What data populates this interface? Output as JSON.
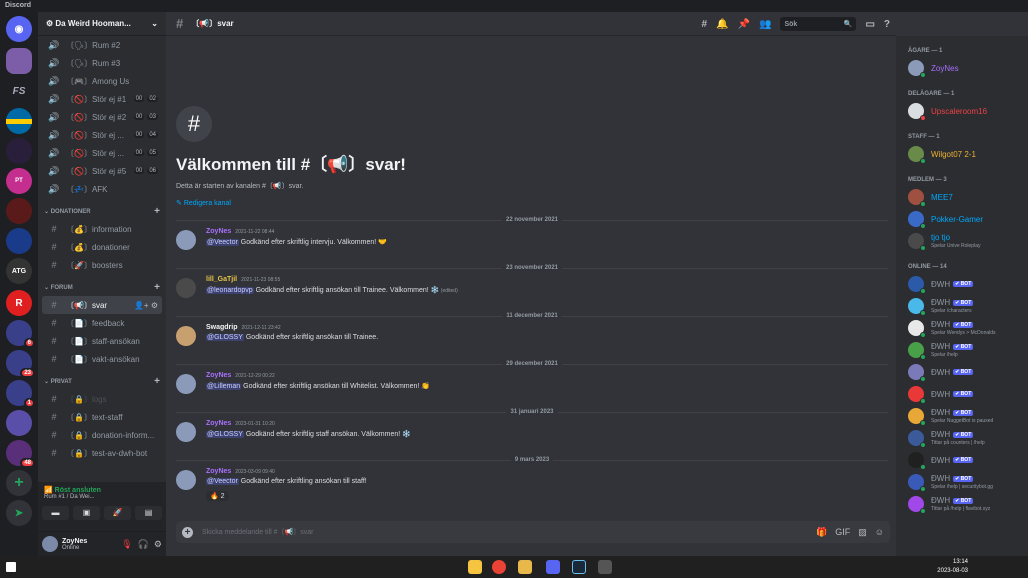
{
  "window": {
    "title": "Discord"
  },
  "server": {
    "name": "Da Weird Hooman..."
  },
  "channels": {
    "voice": [
      {
        "icon": "🗣",
        "name": "Rum #2"
      },
      {
        "icon": "🗣",
        "name": "Rum #3"
      },
      {
        "icon": "🎮",
        "name": "Among Us"
      },
      {
        "icon": "🚫",
        "name": "Stör ej #1",
        "counts": [
          "00",
          "02"
        ]
      },
      {
        "icon": "🚫",
        "name": "Stör ej #2",
        "counts": [
          "00",
          "03"
        ]
      },
      {
        "icon": "🚫",
        "name": "Stör ej ...",
        "counts": [
          "00",
          "04"
        ]
      },
      {
        "icon": "🚫",
        "name": "Stör ej ...",
        "counts": [
          "00",
          "05"
        ]
      },
      {
        "icon": "🚫",
        "name": "Stör ej #5",
        "counts": [
          "00",
          "06"
        ]
      },
      {
        "icon": "💤",
        "name": "AFK"
      }
    ],
    "categories": {
      "donationer": "DONATIONER",
      "forum": "FORUM",
      "privat": "PRIVAT"
    },
    "donationer": [
      {
        "icon": "💰",
        "name": "information"
      },
      {
        "icon": "💰",
        "name": "donationer"
      },
      {
        "icon": "🚀",
        "name": "boosters"
      }
    ],
    "forum": [
      {
        "icon": "📢",
        "name": "svar"
      },
      {
        "icon": "📄",
        "name": "feedback"
      },
      {
        "icon": "📄",
        "name": "staff-ansökan"
      },
      {
        "icon": "📄",
        "name": "vakt-ansökan"
      }
    ],
    "privat": [
      {
        "icon": "🔒",
        "name": "logs"
      },
      {
        "icon": "🔒",
        "name": "text-staff"
      },
      {
        "icon": "🔒",
        "name": "donation-inform..."
      },
      {
        "icon": "🔒",
        "name": "test-av-dwh-bot"
      }
    ]
  },
  "voice_panel": {
    "status": "Röst ansluten",
    "location": "Rum #1 / Da Wei..."
  },
  "user": {
    "name": "ZoyNes",
    "status": "Online"
  },
  "header": {
    "channel": "〔📢〕svar",
    "search_placeholder": "Sök"
  },
  "welcome": {
    "title": "Välkommen till #〔📢〕svar!",
    "subtitle": "Detta är starten av kanalen #〔📢〕svar.",
    "edit": "Redigera kanal"
  },
  "dates": [
    "22 november 2021",
    "23 november 2021",
    "11 december 2021",
    "29 december 2021",
    "31 januari 2023",
    "9 mars 2023"
  ],
  "messages": [
    {
      "author": "ZoyNes",
      "color": "#a970ff",
      "time": "2021-11-22 08:44",
      "mention": "@Veector",
      "text": " Godkänd efter skriftlig intervju. Välkommen! 🤝"
    },
    {
      "author": "lill_GaTjil",
      "color": "#e6c547",
      "time": "2021-11-23 08:55",
      "mention": "@leonardopvp",
      "text": " Godkänd efter skriftlig ansökan till Trainee. Välkommen! ❄️",
      "edited": "(edited)"
    },
    {
      "author": "Swagdrip",
      "color": "#f2f3f5",
      "time": "2021-12-11 23:42",
      "mention": "@GLOSSY",
      "text": "  Godkänd efter skriftlig ansökan till Trainee."
    },
    {
      "author": "ZoyNes",
      "color": "#a970ff",
      "time": "2021-12-29 00:22",
      "mention": "@Lilleman",
      "text": " Godkänd efter skriftlig ansökan till Whitelist. Välkommen! 👏"
    },
    {
      "author": "ZoyNes",
      "color": "#a970ff",
      "time": "2023-01-31 10:20",
      "mention": "@GLOSSY",
      "text": " Godkänd efter skriftlig staff ansökan. Välkommen! ❄️"
    },
    {
      "author": "ZoyNes",
      "color": "#a970ff",
      "time": "2023-03-09 09:40",
      "mention": "@Veector",
      "text": " Godkänd efter skriftling ansökan till staff!",
      "reaction": "🔥 2"
    }
  ],
  "composer": {
    "placeholder": "Skicka meddelande till #〔📢〕svar"
  },
  "members": {
    "categories": [
      "ÄGARE — 1",
      "DELÄGARE — 1",
      "STAFF — 1",
      "MEDLEM — 3",
      "ONLINE — 14"
    ],
    "owner": [
      {
        "name": "ZoyNes",
        "color": "#a970ff"
      }
    ],
    "coowner": [
      {
        "name": "Upscaleroom16",
        "color": "#ed4245"
      }
    ],
    "staff": [
      {
        "name": "Wilgot07 2-1",
        "color": "#f0b232"
      }
    ],
    "member": [
      {
        "name": "MEE7",
        "color": "#00a8fc"
      },
      {
        "name": "Pokker-Gamer",
        "color": "#00a8fc"
      },
      {
        "name": "tjo tjo",
        "color": "#00a8fc",
        "status": "Spelar Unive Roleplay"
      }
    ],
    "online": [
      {
        "name": "ÐWH",
        "status": ""
      },
      {
        "name": "ÐWH",
        "status": "Spelar /characters"
      },
      {
        "name": "ÐWH",
        "status": "Spelar Wendys > McDonalds"
      },
      {
        "name": "ÐWH",
        "status": "Spelar /help"
      },
      {
        "name": "ÐWH",
        "status": ""
      },
      {
        "name": "ÐWH",
        "status": ""
      },
      {
        "name": "ÐWH",
        "status": "Spelar NuggetBot is paused"
      },
      {
        "name": "ÐWH",
        "status": "Tittar på counters | /help"
      },
      {
        "name": "ÐWH",
        "status": ""
      },
      {
        "name": "ÐWH",
        "status": "Spelar /help | securitybot.gg"
      },
      {
        "name": "ÐWH",
        "status": "Tittar på /help | flavibot.xyz"
      }
    ],
    "bot_label": "✔ BOT"
  },
  "taskbar": {
    "time": "13:14",
    "date": "2023-08-03"
  }
}
